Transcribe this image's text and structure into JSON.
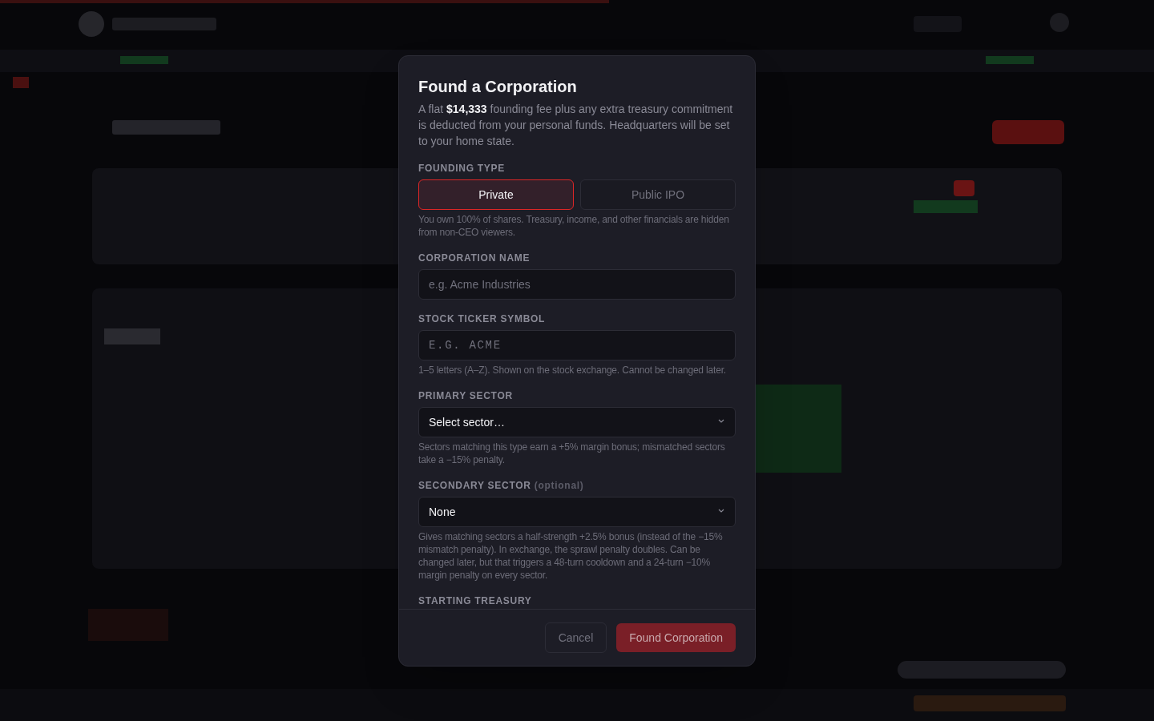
{
  "dialog": {
    "title": "Found a Corporation",
    "description": "A flat **$14,333** founding fee plus any extra treasury commitment is deducted from your personal funds. Headquarters will be set to your home state.",
    "sections": [
      {
        "kind": "toggle",
        "label": "FOUNDING TYPE",
        "options": [
          {
            "label": "Private",
            "selected": true
          },
          {
            "label": "Public IPO",
            "selected": false
          }
        ],
        "help": "You own 100% of shares. Treasury, income, and other financials are hidden from non-CEO viewers."
      },
      {
        "kind": "text",
        "label": "CORPORATION NAME",
        "placeholder": "e.g. Acme Industries"
      },
      {
        "kind": "ticker",
        "label": "STOCK TICKER SYMBOL",
        "placeholder": "E.G. ACME",
        "help": "1–5 letters (A–Z). Shown on the stock exchange. Cannot be changed later."
      },
      {
        "kind": "select",
        "label": "PRIMARY SECTOR",
        "value": "Select sector…",
        "help": "Sectors matching this type earn a +5% margin bonus; mismatched sectors take a −15% penalty."
      },
      {
        "kind": "select",
        "label": "SECONDARY SECTOR",
        "label_note": "(optional)",
        "value": "None",
        "help": "Gives matching sectors a half-strength +2.5% bonus (instead of the −15% mismatch penalty). In exchange, the sprawl penalty doubles. Can be changed later, but that triggers a 48-turn cooldown and a 24-turn −10% margin penalty on every sector."
      },
      {
        "kind": "heading",
        "label": "STARTING TREASURY"
      }
    ],
    "buttons": [
      {
        "label": "Cancel",
        "kind": "secondary",
        "disabled": false
      },
      {
        "label": "Found Corporation",
        "kind": "primary",
        "disabled": true
      }
    ]
  }
}
